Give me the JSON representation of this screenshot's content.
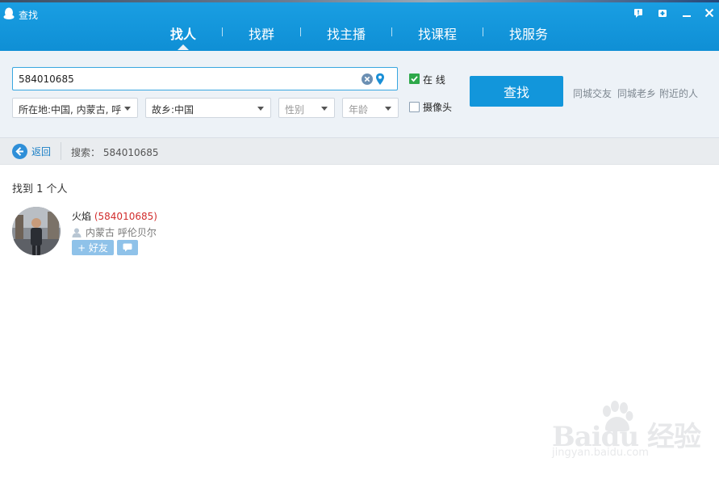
{
  "window": {
    "title": "查找"
  },
  "tabs": [
    {
      "label": "找人",
      "active": true
    },
    {
      "label": "找群",
      "active": false
    },
    {
      "label": "找主播",
      "active": false
    },
    {
      "label": "找课程",
      "active": false
    },
    {
      "label": "找服务",
      "active": false
    }
  ],
  "search": {
    "value": "584010685",
    "button_label": "查找"
  },
  "filters": {
    "location": "所在地:中国, 内蒙古, 呼",
    "hometown": "故乡:中国",
    "gender": "性别",
    "age": "年龄",
    "online_label": "在  线",
    "online_checked": true,
    "camera_label": "摄像头",
    "camera_checked": false
  },
  "quick_links": [
    "同城交友",
    "同城老乡",
    "附近的人"
  ],
  "backbar": {
    "back_label": "返回",
    "search_echo": "搜索： 584010685"
  },
  "results": {
    "count_text": "找到 1 个人",
    "items": [
      {
        "name": "火焰",
        "qq": "(584010685)",
        "location": "内蒙古 呼伦贝尔",
        "add_label": "+ 好友"
      }
    ]
  },
  "watermark": {
    "line1": "Baidu 经验",
    "line2": "jingyan.baidu.com"
  },
  "colors": {
    "header_blue": "#1296db",
    "panel_bg": "#edf2f7",
    "online_green": "#2ea84a",
    "qq_red": "#d12c2c",
    "action_light_blue": "#8fc2e9"
  }
}
